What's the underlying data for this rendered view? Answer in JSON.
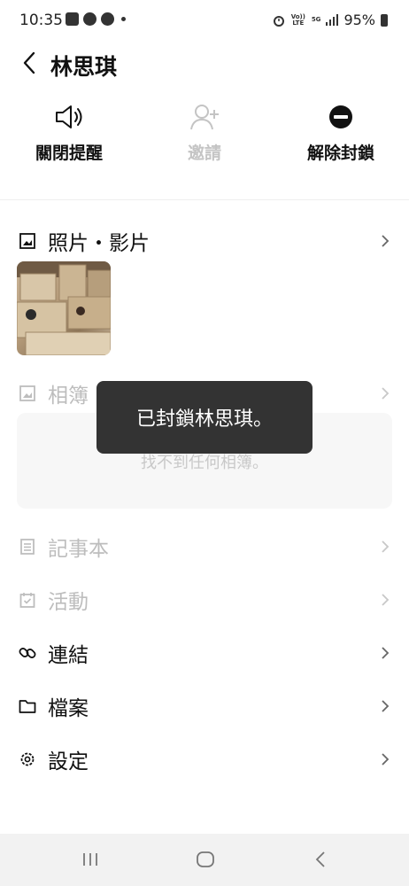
{
  "status_bar": {
    "time": "10:35",
    "left_icons": [
      "gallery-icon",
      "facebook-icon",
      "line-icon"
    ],
    "volte": "Vo)) LTE",
    "network": "5G",
    "battery": "95%"
  },
  "header": {
    "title": "林思琪"
  },
  "actions": [
    {
      "label": "關閉提醒",
      "icon": "speaker-icon",
      "enabled": true
    },
    {
      "label": "邀請",
      "icon": "add-friend-icon",
      "enabled": false
    },
    {
      "label": "解除封鎖",
      "icon": "unblock-icon",
      "enabled": true
    }
  ],
  "sections": {
    "photos": {
      "label": "照片・影片",
      "icon": "photo-icon"
    },
    "albums": {
      "label": "相簿",
      "icon": "album-icon",
      "empty_text": "找不到任何相簿。"
    },
    "notes": {
      "label": "記事本",
      "icon": "note-icon"
    },
    "events": {
      "label": "活動",
      "icon": "calendar-icon"
    },
    "links": {
      "label": "連結",
      "icon": "link-icon"
    },
    "files": {
      "label": "檔案",
      "icon": "folder-icon"
    },
    "settings": {
      "label": "設定",
      "icon": "gear-icon"
    }
  },
  "toast": {
    "text": "已封鎖林思琪。"
  },
  "nav": [
    "recent-apps-icon",
    "home-icon",
    "back-icon"
  ]
}
